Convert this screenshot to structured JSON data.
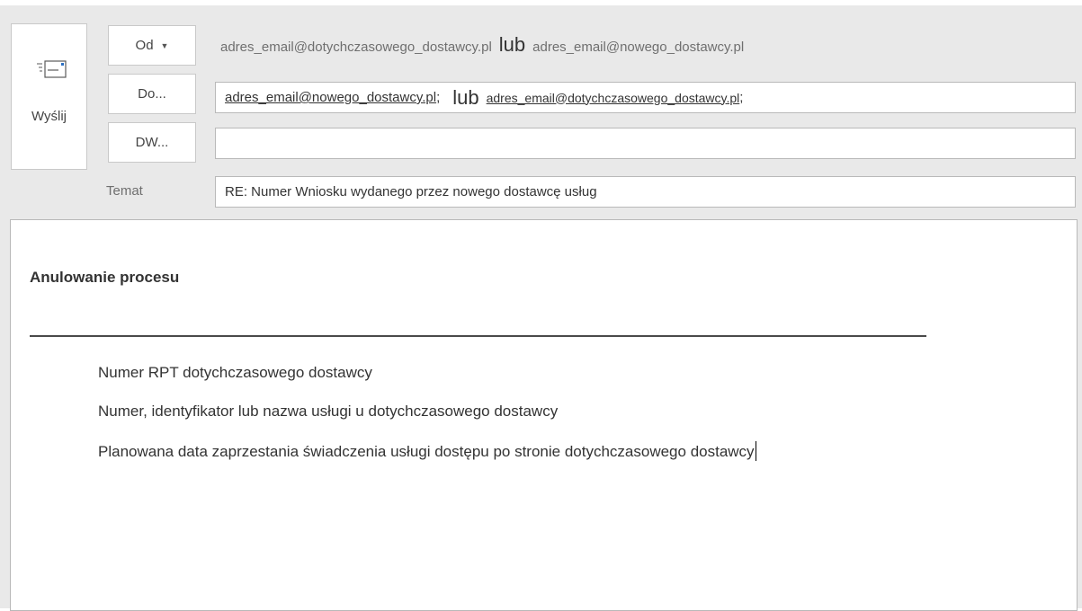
{
  "send": {
    "label": "Wyślij",
    "icon": "envelope-send-icon"
  },
  "header": {
    "from_button": "Od",
    "to_button": "Do...",
    "cc_button": "DW...",
    "subject_label": "Temat"
  },
  "from": {
    "address_1": "adres_email@dotychczasowego_dostawcy.pl",
    "separator": "lub",
    "address_2": "adres_email@nowego_dostawcy.pl"
  },
  "to": {
    "recipient_1": "adres_email@nowego_dostawcy.pl",
    "delimiter_1": ";",
    "separator": "lub",
    "recipient_2": "adres_email@dotychczasowego_dostawcy.pl",
    "delimiter_2": ";"
  },
  "cc": {
    "value": ""
  },
  "subject": {
    "value": "RE: Numer Wniosku wydanego przez nowego dostawcę usług"
  },
  "body": {
    "heading": "Anulowanie procesu",
    "lines": [
      "Numer RPT dotychczasowego dostawcy",
      "Numer, identyfikator lub nazwa usługi u dotychczasowego dostawcy",
      "Planowana data zaprzestania świadczenia usługi dostępu po stronie dotychczasowego dostawcy"
    ]
  },
  "colors": {
    "window_bg": "#e9e9e9",
    "field_border": "#b9b9b9",
    "text_muted": "#6f6f6f",
    "text": "#333333"
  }
}
